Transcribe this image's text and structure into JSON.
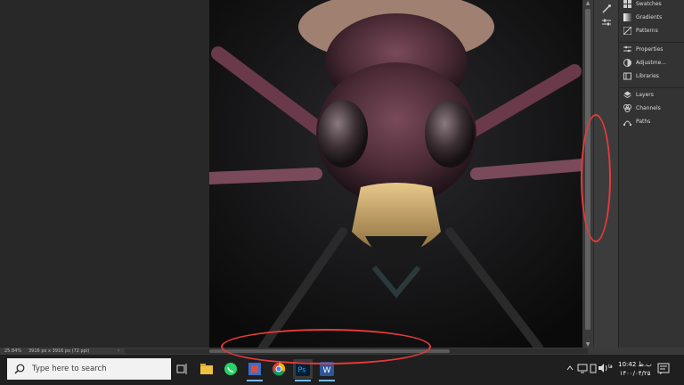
{
  "app": {
    "name": "Adobe Photoshop"
  },
  "status_bar": {
    "zoom": "25.84%",
    "doc_info": "3916 px x 3916 px (72 ppi)"
  },
  "panels": {
    "group1": [
      {
        "label": "Swatches",
        "icon": "swatches-icon"
      },
      {
        "label": "Gradients",
        "icon": "gradients-icon"
      },
      {
        "label": "Patterns",
        "icon": "patterns-icon"
      }
    ],
    "group2": [
      {
        "label": "Properties",
        "icon": "properties-icon"
      },
      {
        "label": "Adjustme...",
        "icon": "adjustments-icon"
      },
      {
        "label": "Libraries",
        "icon": "libraries-icon"
      }
    ],
    "group3": [
      {
        "label": "Layers",
        "icon": "layers-icon"
      },
      {
        "label": "Channels",
        "icon": "channels-icon"
      },
      {
        "label": "Paths",
        "icon": "paths-icon"
      }
    ]
  },
  "taskbar": {
    "search_placeholder": "Type here to search",
    "apps": [
      "task-view",
      "file-explorer",
      "whatsapp",
      "unknown-app",
      "chrome",
      "photoshop",
      "word"
    ],
    "clock_time": "10:42 ب.ظ",
    "clock_date": "۱۴۰۰/۰۴/۲۵"
  },
  "colors": {
    "annotation": "#e53a3a",
    "panel_bg": "#333333",
    "taskbar_bg": "#1f1f1f"
  }
}
